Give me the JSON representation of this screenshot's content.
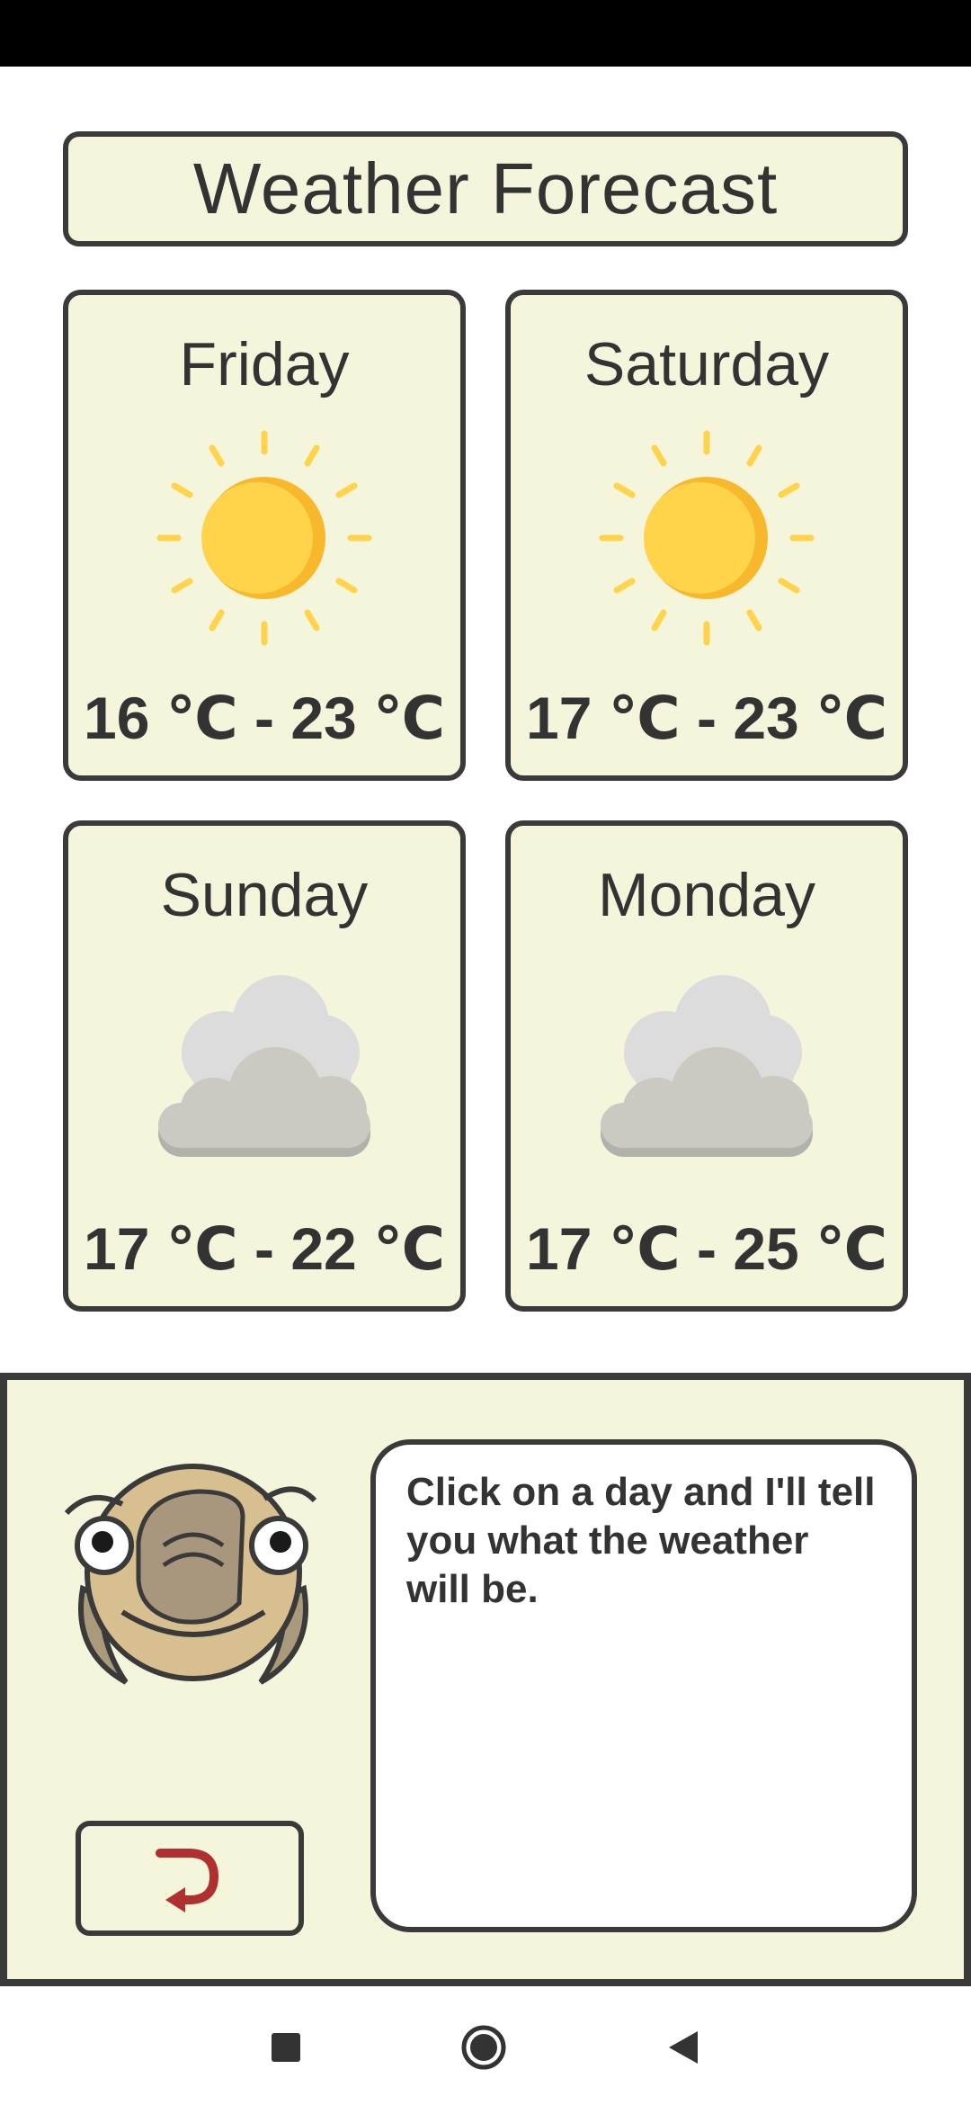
{
  "app": {
    "title": "Weather Forecast"
  },
  "forecast": [
    {
      "day": "Friday",
      "icon": "sun-icon",
      "temp": "16 ℃ - 23 ℃"
    },
    {
      "day": "Saturday",
      "icon": "sun-icon",
      "temp": "17 ℃ - 23 ℃"
    },
    {
      "day": "Sunday",
      "icon": "cloud-icon",
      "temp": "17 ℃ - 22 ℃"
    },
    {
      "day": "Monday",
      "icon": "cloud-icon",
      "temp": "17 ℃ - 25 ℃"
    }
  ],
  "assistant": {
    "message": "Click on a day and I'll tell you what the weather will be.",
    "back_icon": "undo-arrow-icon"
  },
  "nav": {
    "icons": [
      "recents-square-icon",
      "home-circle-icon",
      "back-triangle-icon"
    ]
  },
  "colors": {
    "card_bg": "#f5f5dc",
    "border": "#3a3a3a",
    "sun": "#ffd44a",
    "back_arrow": "#b03030"
  }
}
